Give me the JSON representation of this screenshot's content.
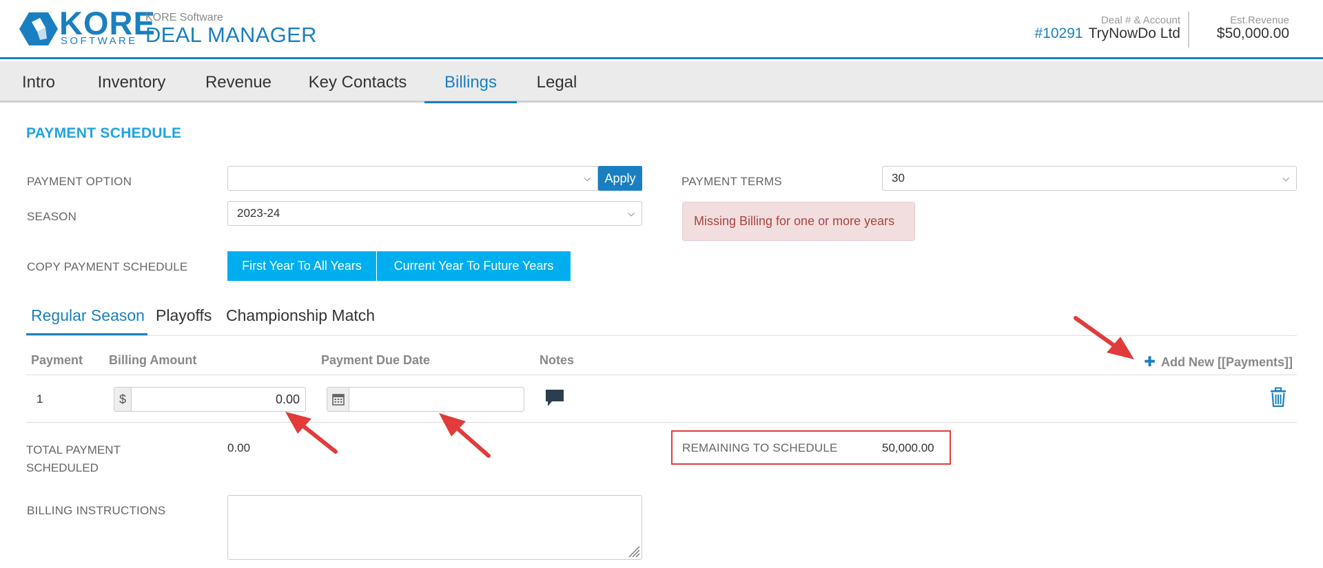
{
  "header": {
    "logo_text": "KORE",
    "logo_sub": "SOFTWARE",
    "company": "KORE Software",
    "app_title": "DEAL MANAGER",
    "deal_label": "Deal # & Account",
    "deal_number": "#10291",
    "account_name": "TryNowDo Ltd",
    "revenue_label": "Est.Revenue",
    "revenue_value": "$50,000.00"
  },
  "tabs": [
    {
      "label": "Intro"
    },
    {
      "label": "Inventory"
    },
    {
      "label": "Revenue"
    },
    {
      "label": "Key Contacts"
    },
    {
      "label": "Billings",
      "active": true
    },
    {
      "label": "Legal"
    }
  ],
  "section": {
    "title": "PAYMENT SCHEDULE",
    "payment_option_label": "PAYMENT OPTION",
    "payment_option_value": "",
    "apply_label": "Apply",
    "season_label": "SEASON",
    "season_value": "2023-24",
    "payment_terms_label": "PAYMENT TERMS",
    "payment_terms_value": "30",
    "alert_text": "Missing Billing for one or more years",
    "copy_label": "COPY PAYMENT SCHEDULE",
    "copy_first_label": "First Year To All Years",
    "copy_current_label": "Current Year To Future Years"
  },
  "subtabs": [
    {
      "label": "Regular Season",
      "active": true
    },
    {
      "label": "Playoffs"
    },
    {
      "label": "Championship Match"
    }
  ],
  "table": {
    "headers": {
      "payment": "Payment",
      "billing_amount": "Billing Amount",
      "due_date": "Payment Due Date",
      "notes": "Notes"
    },
    "add_new_label": "Add New [[Payments]]",
    "rows": [
      {
        "payment": "1",
        "currency": "$",
        "amount": "0.00",
        "due_date": ""
      }
    ]
  },
  "totals": {
    "total_label": "TOTAL PAYMENT SCHEDULED",
    "total_value": "0.00",
    "remaining_label": "REMAINING TO SCHEDULE",
    "remaining_value": "50,000.00"
  },
  "billing": {
    "instructions_label": "BILLING INSTRUCTIONS",
    "instructions_value": ""
  },
  "colors": {
    "brand": "#1a7fc1",
    "accent_button": "#00aeef",
    "alert_bg": "#f2dede",
    "alert_text": "#a94442",
    "annotation": "#e23b3b"
  }
}
